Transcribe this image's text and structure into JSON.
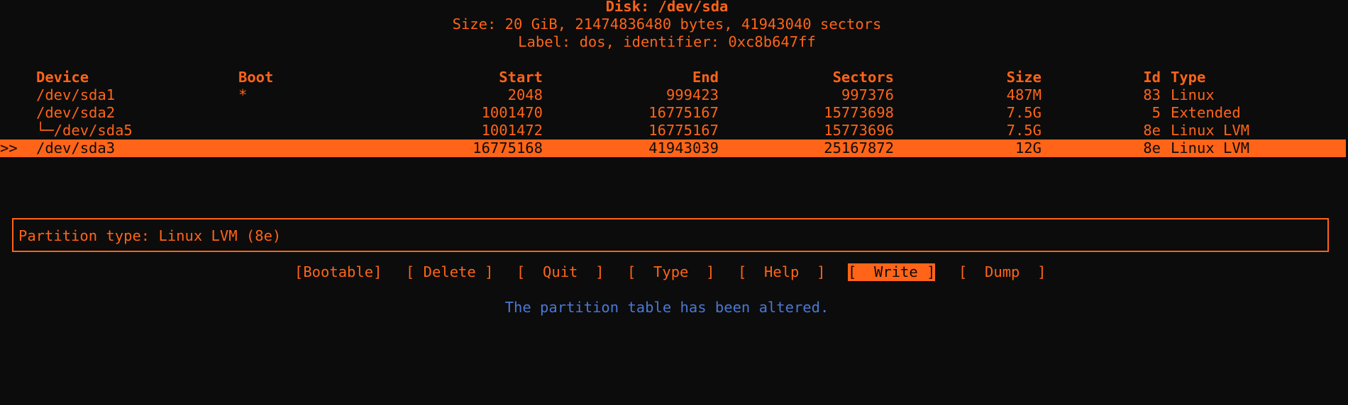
{
  "header": {
    "disk_title": "Disk: /dev/sda",
    "size_line": "Size: 20 GiB, 21474836480 bytes, 41943040 sectors",
    "label_line": "Label: dos, identifier: 0xc8b647ff"
  },
  "table": {
    "columns": {
      "device": "Device",
      "boot": "Boot",
      "start": "Start",
      "end": "End",
      "sectors": "Sectors",
      "size": "Size",
      "id": "Id",
      "type": "Type"
    },
    "rows": [
      {
        "marker": "",
        "device": "/dev/sda1",
        "boot": "*",
        "start": "2048",
        "end": "999423",
        "sectors": "997376",
        "size": "487M",
        "id": "83",
        "type": "Linux"
      },
      {
        "marker": "",
        "device": "/dev/sda2",
        "boot": "",
        "start": "1001470",
        "end": "16775167",
        "sectors": "15773698",
        "size": "7.5G",
        "id": "5",
        "type": "Extended"
      },
      {
        "marker": "",
        "device": "└─/dev/sda5",
        "boot": "",
        "start": "1001472",
        "end": "16775167",
        "sectors": "15773696",
        "size": "7.5G",
        "id": "8e",
        "type": "Linux LVM"
      },
      {
        "marker": ">>",
        "device": "/dev/sda3",
        "boot": "",
        "start": "16775168",
        "end": "41943039",
        "sectors": "25167872",
        "size": "12G",
        "id": "8e",
        "type": "Linux LVM"
      }
    ]
  },
  "info": {
    "text": "Partition type: Linux LVM (8e)"
  },
  "menu": {
    "bootable": "[Bootable]",
    "delete": "[ Delete ]",
    "quit": "[  Quit  ]",
    "type": "[  Type  ]",
    "help": "[  Help  ]",
    "write": "[  Write ]",
    "dump": "[  Dump  ]"
  },
  "status": {
    "message": "The partition table has been altered."
  },
  "colors": {
    "foreground": "#ff6418",
    "background": "#0c0c0c",
    "status_text": "#4a78d6"
  }
}
